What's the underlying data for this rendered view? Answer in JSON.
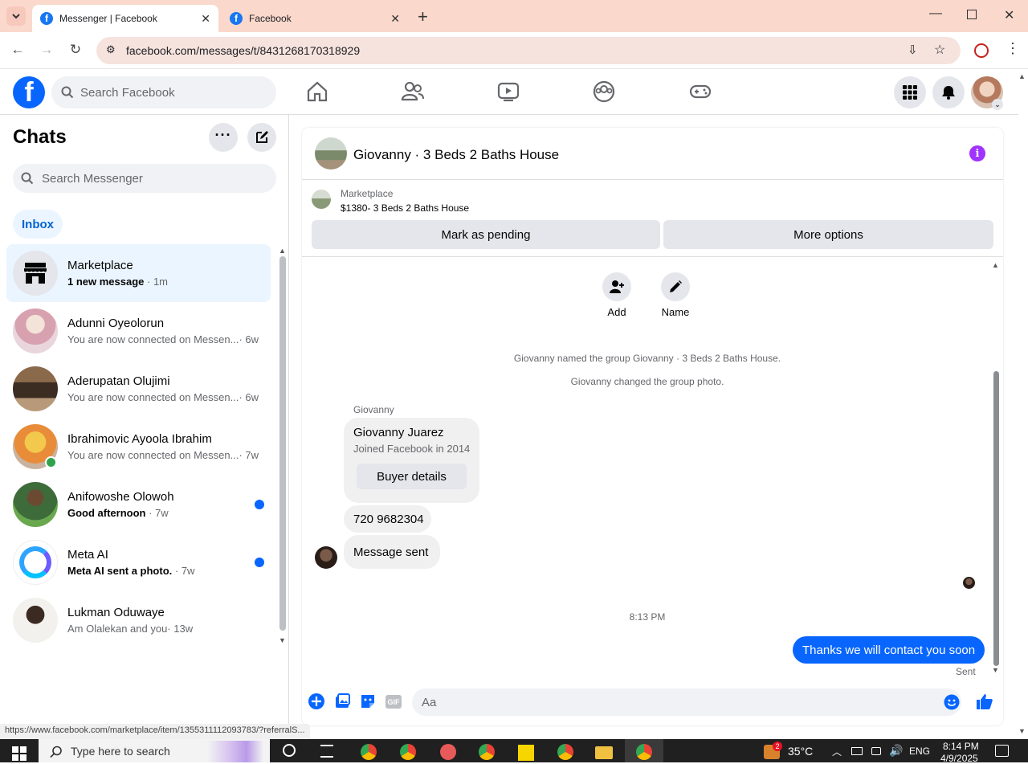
{
  "browser": {
    "tabs": [
      {
        "title": "Messenger | Facebook",
        "active": true
      },
      {
        "title": "Facebook",
        "active": false
      }
    ],
    "url": "facebook.com/messages/t/8431268170318929",
    "status_url": "https://www.facebook.com/marketplace/item/1355311112093783/?referralS..."
  },
  "fb_header": {
    "search_placeholder": "Search Facebook"
  },
  "sidebar": {
    "title": "Chats",
    "search_placeholder": "Search Messenger",
    "filter_label": "Inbox",
    "chats": [
      {
        "name": "Marketplace",
        "preview": "1 new message",
        "time": "· 1m",
        "bold": true,
        "selected": true
      },
      {
        "name": "Adunni Oyeolorun",
        "preview": "You are now connected on Messen...",
        "time": "· 6w"
      },
      {
        "name": "Aderupatan Olujimi",
        "preview": "You are now connected on Messen...",
        "time": "· 6w"
      },
      {
        "name": "Ibrahimovic Ayoola Ibrahim",
        "preview": "You are now connected on Messen...",
        "time": "· 7w",
        "online": true
      },
      {
        "name": "Anifowoshe Olowoh",
        "preview": "Good afternoon",
        "time": "· 7w",
        "bold": true,
        "unread": true
      },
      {
        "name": "Meta AI",
        "preview": "Meta AI sent a photo.",
        "time": "· 7w",
        "bold": true,
        "unread": true
      },
      {
        "name": "Lukman Oduwaye",
        "preview": "Am Olalekan and you",
        "time": "· 13w"
      }
    ]
  },
  "conversation": {
    "title": "Giovanny · 3 Beds 2 Baths House",
    "marketplace_label": "Marketplace",
    "listing": "$1380- 3 Beds 2 Baths House",
    "mark_pending": "Mark as pending",
    "more_options": "More options",
    "add_label": "Add",
    "name_label": "Name",
    "system_messages": [
      "Giovanny named the group Giovanny · 3 Beds 2 Baths House.",
      "Giovanny changed the group photo."
    ],
    "sender_name": "Giovanny",
    "card_name": "Giovanny Juarez",
    "card_sub": "Joined Facebook in 2014",
    "buyer_details": "Buyer details",
    "phone_msg": "720 9682304",
    "sent_msg": "Message sent",
    "timestamp": "8:13 PM",
    "my_msg": "Thanks we will contact you soon",
    "sent_status": "Sent",
    "composer_placeholder": "Aa"
  },
  "taskbar": {
    "search_placeholder": "Type here to search",
    "temperature": "35°C",
    "lang": "ENG",
    "time": "8:14 PM",
    "date": "4/9/2025",
    "weather_badge": "2"
  },
  "colors": {
    "brand": "#0866ff",
    "info": "#a033ff",
    "tabbar": "#fbd8cc"
  }
}
